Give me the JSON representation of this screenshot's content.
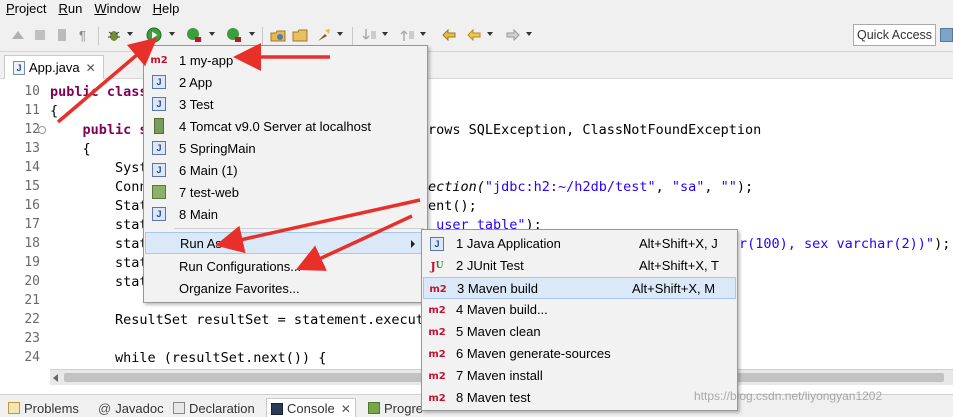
{
  "menubar": {
    "items": [
      {
        "label": "Project",
        "mnemonic": "P"
      },
      {
        "label": "Run",
        "mnemonic": "R"
      },
      {
        "label": "Window",
        "mnemonic": "W"
      },
      {
        "label": "Help",
        "mnemonic": "H"
      }
    ]
  },
  "toolbar": {
    "quick_access_label": "Quick Access"
  },
  "editor": {
    "tab_label": "App.java",
    "tab_icon": "J",
    "lines": [
      {
        "num": "10",
        "text": "public class"
      },
      {
        "num": "11",
        "text": "{"
      },
      {
        "num": "12",
        "text": "    public s",
        "after": "rows SQLException, ClassNotFoundException"
      },
      {
        "num": "13",
        "text": "    {"
      },
      {
        "num": "14",
        "text": "        Syst"
      },
      {
        "num": "15",
        "text": "        Conn",
        "after_italic": "ection(",
        "after_str1": "\"jdbc:h2:~/h2db/test\"",
        "after_rest1": ", ",
        "after_str2": "\"sa\"",
        "after_rest2": ", ",
        "after_str3": "\"\"",
        "after_rest3": ");"
      },
      {
        "num": "16",
        "text": "        Stat",
        "after": "ent();"
      },
      {
        "num": "17",
        "text": "        stat",
        "after_str": " user table\"",
        "after_rest": ");"
      },
      {
        "num": "18",
        "text": "        stat",
        "after_str": "r(100), sex varchar(2))\"",
        "after_rest": ");"
      },
      {
        "num": "19",
        "text": "        stat"
      },
      {
        "num": "20",
        "text": "        stat"
      },
      {
        "num": "21",
        "text": ""
      },
      {
        "num": "22",
        "text": "        ResultSet resultSet = statement.execute"
      },
      {
        "num": "23",
        "text": ""
      },
      {
        "num": "24",
        "text": "        while (resultSet.next()) {"
      }
    ]
  },
  "run_menu": {
    "items": [
      {
        "label": "1 my-app",
        "icon": "m2"
      },
      {
        "label": "2 App",
        "icon": "J"
      },
      {
        "label": "3 Test",
        "icon": "J"
      },
      {
        "label": "4 Tomcat v9.0 Server at localhost",
        "icon": "tomcat"
      },
      {
        "label": "5 SpringMain",
        "icon": "J"
      },
      {
        "label": "6 Main (1)",
        "icon": "J"
      },
      {
        "label": "7 test-web",
        "icon": "web"
      },
      {
        "label": "8 Main",
        "icon": "J"
      }
    ],
    "run_as_label": "Run As",
    "run_configurations_label": "Run Configurations...",
    "organize_favorites_label": "Organize Favorites..."
  },
  "run_as_menu": {
    "items": [
      {
        "label": "1 Java Application",
        "shortcut": "Alt+Shift+X, J",
        "icon": "J"
      },
      {
        "label": "2 JUnit Test",
        "shortcut": "Alt+Shift+X, T",
        "icon": "JU"
      },
      {
        "label": "3 Maven build",
        "shortcut": "Alt+Shift+X, M",
        "icon": "m2"
      },
      {
        "label": "4 Maven build...",
        "shortcut": "",
        "icon": "m2"
      },
      {
        "label": "5 Maven clean",
        "shortcut": "",
        "icon": "m2"
      },
      {
        "label": "6 Maven generate-sources",
        "shortcut": "",
        "icon": "m2"
      },
      {
        "label": "7 Maven install",
        "shortcut": "",
        "icon": "m2"
      },
      {
        "label": "8 Maven test",
        "shortcut": "",
        "icon": "m2"
      }
    ]
  },
  "bottom_tabs": [
    {
      "label": "Problems",
      "icon": "problems-icon"
    },
    {
      "label": "Javadoc",
      "icon": "at-icon"
    },
    {
      "label": "Declaration",
      "icon": "declaration-icon"
    },
    {
      "label": "Console",
      "icon": "console-icon",
      "active": true
    },
    {
      "label": "Progre",
      "icon": "progress-icon"
    }
  ],
  "watermark": "https://blog.csdn.net/liyongyan1202",
  "colors": {
    "keyword": "#7f0055",
    "string": "#2a00ff",
    "menu_highlight": "#dae8f7",
    "arrow_red": "#e8302a",
    "maven_red": "#c8102e"
  }
}
